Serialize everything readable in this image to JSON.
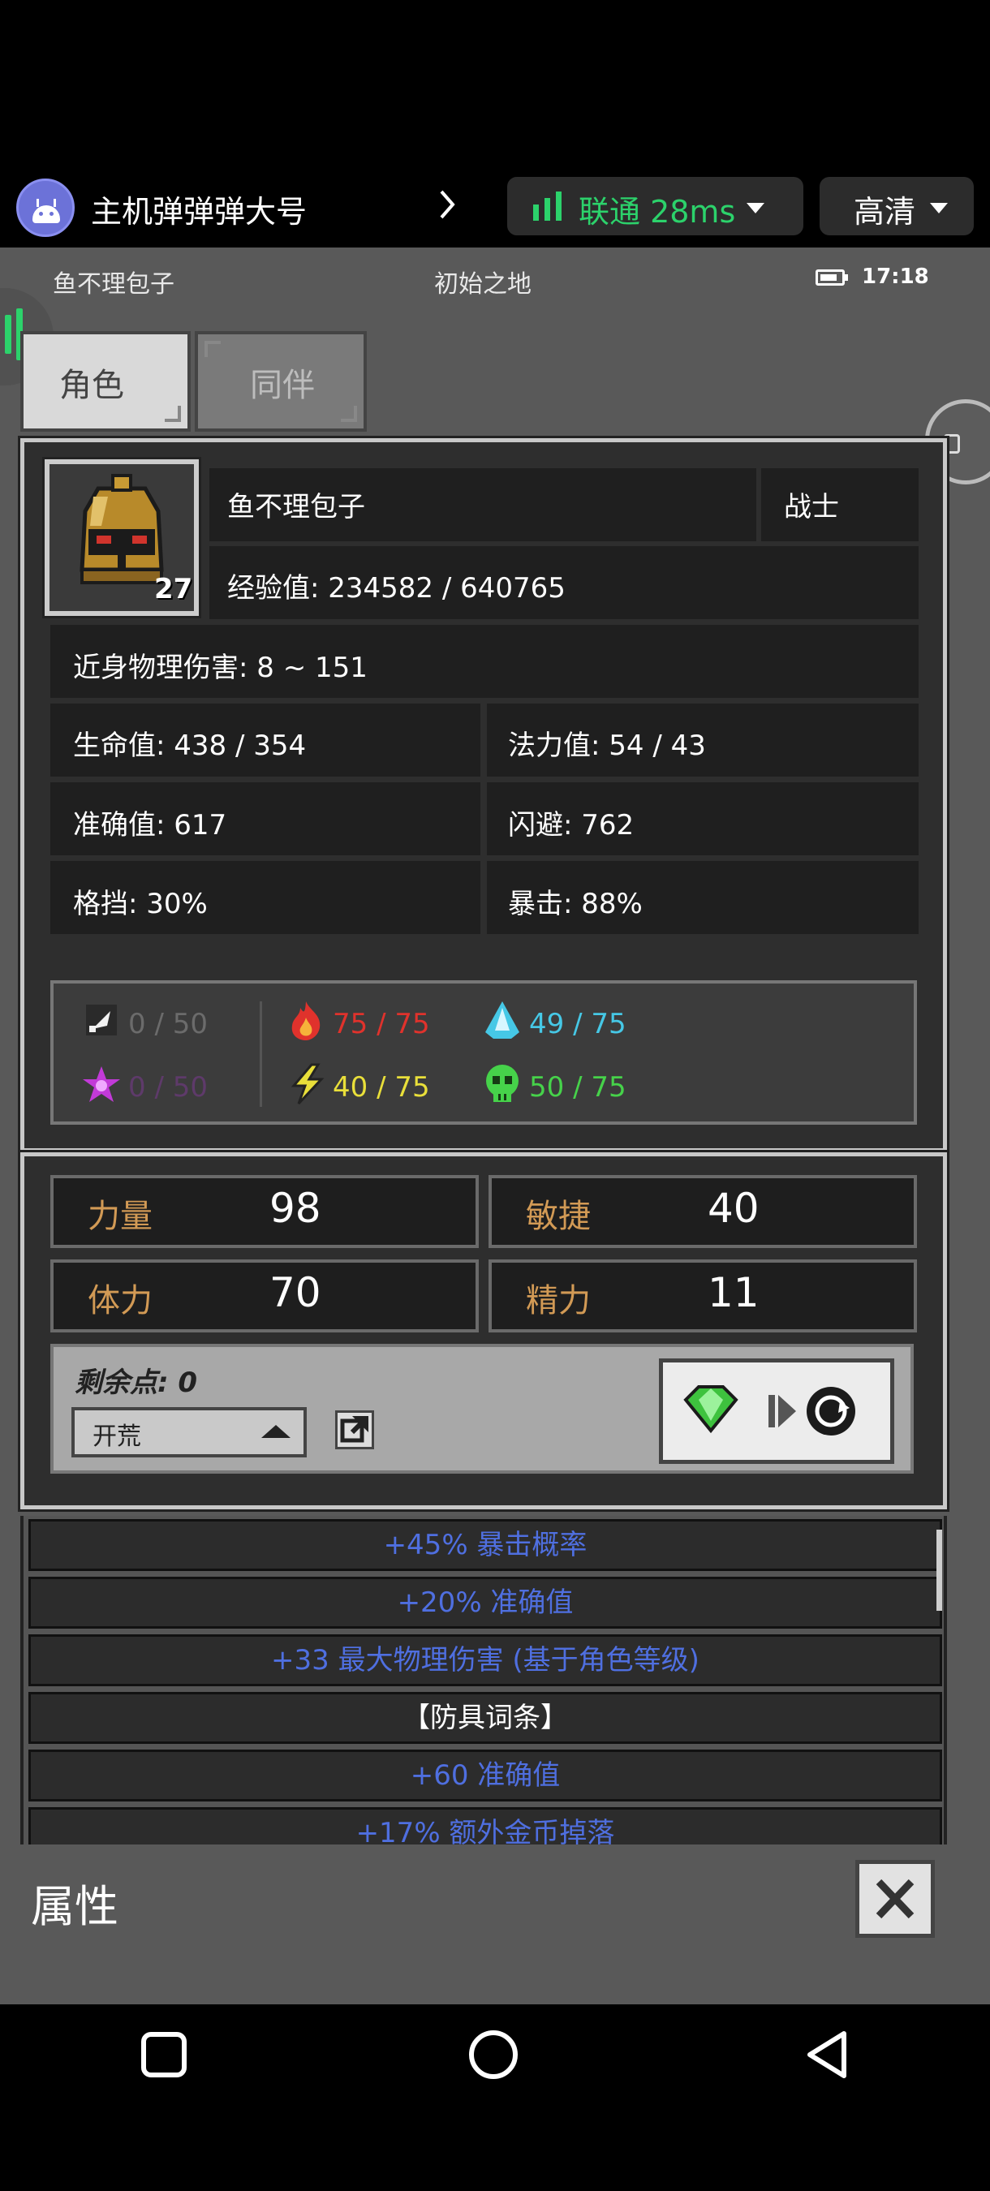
{
  "stream_bar": {
    "host_name": "主机弹弹弹大号",
    "network": "联通 28ms",
    "quality": "高清"
  },
  "status": {
    "player": "鱼不理包子",
    "location": "初始之地",
    "time": "17:18"
  },
  "tabs": [
    {
      "label": "角色",
      "active": true
    },
    {
      "label": "同伴",
      "active": false
    }
  ],
  "character": {
    "name": "鱼不理包子",
    "class": "战士",
    "level": "27",
    "experience": "经验值: 234582 / 640765",
    "melee_damage": "近身物理伤害: 8 ~ 151",
    "hp": "生命值: 438 / 354",
    "mp": "法力值: 54 / 43",
    "accuracy": "准确值: 617",
    "dodge": "闪避: 762",
    "block": "格挡: 30%",
    "crit": "暴击: 88%"
  },
  "resistances": [
    {
      "icon": "physical-resist-icon",
      "value": "0 / 50",
      "color": "#6b6b6b"
    },
    {
      "icon": "fire-resist-icon",
      "value": "75 / 75",
      "color": "#e0322c"
    },
    {
      "icon": "ice-resist-icon",
      "value": "49 / 75",
      "color": "#46c8e6"
    },
    {
      "icon": "arcane-resist-icon",
      "value": "0 / 50",
      "color": "#5e3a6a"
    },
    {
      "icon": "lightning-resist-icon",
      "value": "40 / 75",
      "color": "#e9df3a"
    },
    {
      "icon": "poison-resist-icon",
      "value": "50 / 75",
      "color": "#46d24a"
    }
  ],
  "attributes": {
    "strength_label": "力量",
    "strength_value": "98",
    "agility_label": "敏捷",
    "agility_value": "40",
    "stamina_label": "体力",
    "stamina_value": "70",
    "energy_label": "精力",
    "energy_value": "11"
  },
  "points": {
    "remaining": "剩余点: 0",
    "mode": "开荒"
  },
  "affixes": [
    {
      "text": "+45% 暴击概率",
      "color": "#4f6fe0"
    },
    {
      "text": "+20% 准确值",
      "color": "#4f6fe0"
    },
    {
      "text": "+33 最大物理伤害 (基于角色等级)",
      "color": "#4f6fe0"
    },
    {
      "text": "【防具词条】",
      "color": "#ffffff"
    },
    {
      "text": "+60 准确值",
      "color": "#4f6fe0"
    },
    {
      "text": "+17% 额外金币掉落",
      "color": "#4f6fe0"
    }
  ],
  "footer": {
    "title": "属性"
  }
}
